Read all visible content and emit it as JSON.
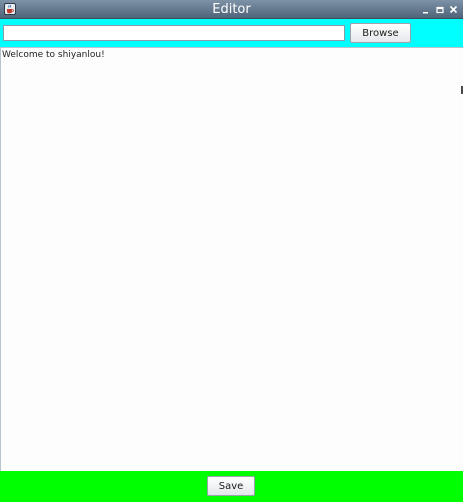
{
  "window": {
    "title": "Editor",
    "icon": "java-cup-icon",
    "controls": {
      "minimize_icon": "minimize-icon",
      "maximize_icon": "maximize-icon",
      "close_icon": "close-icon"
    }
  },
  "toolbar": {
    "path_value": "",
    "path_placeholder": "",
    "browse_label": "Browse",
    "background": "#00ffff"
  },
  "editor": {
    "content": "Welcome to shiyanlou!"
  },
  "bottombar": {
    "save_label": "Save",
    "background": "#00ff00"
  }
}
